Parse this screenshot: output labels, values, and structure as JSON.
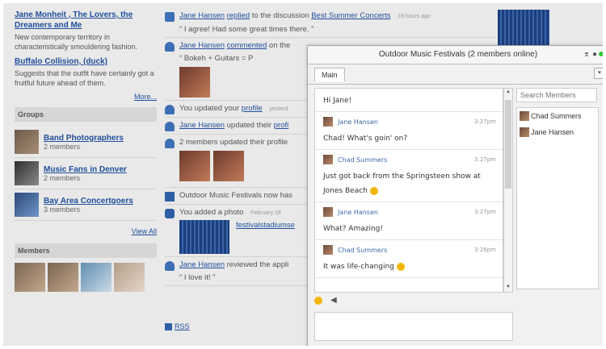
{
  "left": {
    "blocks": [
      {
        "title": "Jane Monheit , The Lovers, the Dreamers and Me",
        "desc": "New contemporary territory in characteristically smouldering fashion."
      },
      {
        "title": "Buffalo Collision, (duck)",
        "desc": "Suggests that the outfit have certainly got a fruitful future ahead of them."
      }
    ],
    "more": "More...",
    "groups_header": "Groups",
    "groups": [
      {
        "name": "Band Photographers",
        "count": "2 members"
      },
      {
        "name": "Music Fans in Denver",
        "count": "2 members"
      },
      {
        "name": "Bay Area Concertgoers",
        "count": "3 members"
      }
    ],
    "view_all": "View All",
    "members_header": "Members"
  },
  "feed": {
    "items": [
      {
        "who": "Jane Hansen",
        "verb": "replied",
        "mid": " to the discussion ",
        "obj": "Best Summer Concerts",
        "time": "18 hours ago",
        "quote": "I agree! Had some great times there."
      },
      {
        "who": "Jane Hansen",
        "verb": "commented",
        "mid": " on the",
        "quote": "Bokeh + Guitars = P"
      },
      {
        "pre": "You updated your ",
        "link": "profile",
        "time": "yesterd"
      },
      {
        "who": "Jane Hansen",
        "mid": " updated their ",
        "link": "profi"
      },
      {
        "pre": "2 members updated their profile"
      },
      {
        "pre": "Outdoor Music Festivals now has"
      },
      {
        "pre": "You added a photo",
        "time": "February 18",
        "link": "festivalstadiumse"
      },
      {
        "who": "Jane Hansen",
        "mid": " reviewed the appli",
        "quote": "I love it!"
      }
    ],
    "rss": "RSS"
  },
  "chat": {
    "title": "Outdoor Music Festivals (2 members online)",
    "tab": "Main",
    "messages": [
      {
        "name": "Chad Summers",
        "time": "",
        "text": "Hi Jane!"
      },
      {
        "name": "Jane Hansen",
        "time": "3:27pm",
        "text": "Chad! What's goin' on?"
      },
      {
        "name": "Chad Summers",
        "time": "3:27pm",
        "text": "Just got back from the Springsteen show at Jones Beach"
      },
      {
        "name": "Jane Hansen",
        "time": "3:27pm",
        "text": "What? Amazing!"
      },
      {
        "name": "Chad Summers",
        "time": "3:28pm",
        "text": "It was life-changing"
      }
    ],
    "search_placeholder": "Search Members",
    "members": [
      "Chad Summers",
      "Jane Hansen"
    ]
  }
}
